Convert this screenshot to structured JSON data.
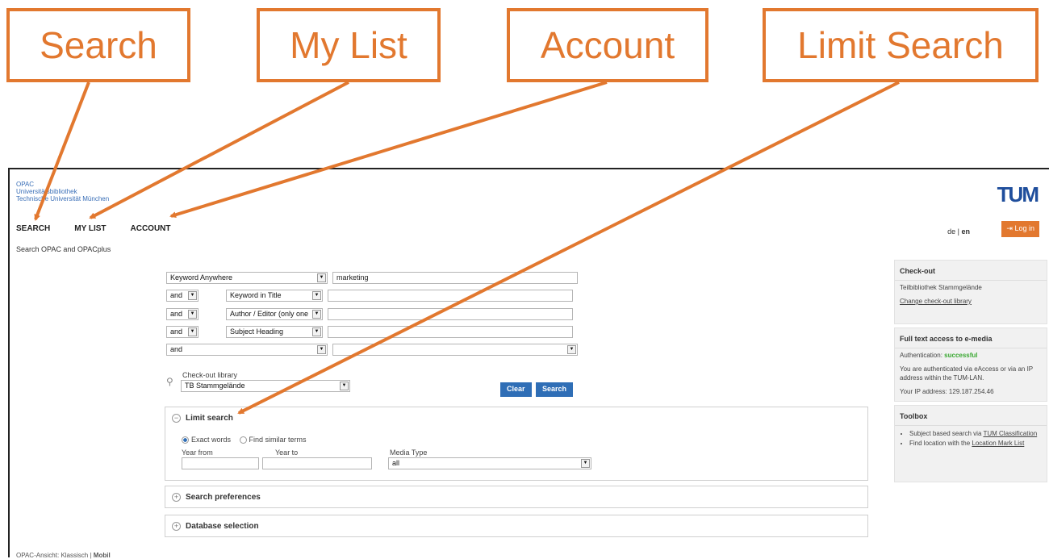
{
  "callouts": [
    {
      "label": "Search"
    },
    {
      "label": "My List"
    },
    {
      "label": "Account"
    },
    {
      "label": "Limit Search"
    }
  ],
  "brand": {
    "lines": [
      "OPAC",
      "Universitätsbibliothek",
      "Technische Universität München"
    ],
    "logo": "TUM"
  },
  "nav": {
    "search": "SEARCH",
    "mylist": "MY LIST",
    "account": "ACCOUNT"
  },
  "lang": {
    "de": "de",
    "sep": "|",
    "en": "en"
  },
  "login": {
    "label": "Log in",
    "icon": "login-icon"
  },
  "subtitle": "Search OPAC and OPACplus",
  "search_rows": [
    {
      "field": "Keyword Anywhere",
      "value": "marketing"
    },
    {
      "op": "and",
      "field": "Keyword in Title",
      "value": ""
    },
    {
      "op": "and",
      "field": "Author / Editor (only one",
      "value": ""
    },
    {
      "op": "and",
      "field": "Subject Heading",
      "value": ""
    },
    {
      "op": "and",
      "value": ""
    }
  ],
  "library": {
    "label": "Check-out library",
    "value": "TB Stammgelände"
  },
  "buttons": {
    "clear": "Clear",
    "search": "Search"
  },
  "limit": {
    "title": "Limit search",
    "exact": "Exact words",
    "similar": "Find similar terms",
    "year_from": "Year from",
    "year_to": "Year  to",
    "media_type": "Media Type",
    "media_value": "all"
  },
  "preferences": {
    "title": "Search preferences"
  },
  "database": {
    "title": "Database selection"
  },
  "sidebar": {
    "checkout_h": "Check-out",
    "checkout_lib": "Teilbibliothek Stammgelände",
    "change_lib": "Change check-out library",
    "fulltext_h": "Full text access to e-media",
    "auth_label": "Authentication:",
    "auth_status": "successful",
    "auth_text": "You are authenticated via eAccess or via an IP address within the TUM-LAN.",
    "ip_text": "Your IP address: 129.187.254.46",
    "toolbox_h": "Toolbox",
    "tool1_pre": "Subject based search via",
    "tool1_link": "TUM Classification",
    "tool2_pre": "Find location with the",
    "tool2_link": "Location Mark List"
  },
  "footer": {
    "label": "OPAC-Ansicht:",
    "classic": "Klassisch",
    "sep": "|",
    "mobile": "Mobil"
  },
  "colors": {
    "accent": "#e2782f",
    "button": "#2f6eb6",
    "link": "#3a6fb7",
    "success": "#3aa832"
  }
}
